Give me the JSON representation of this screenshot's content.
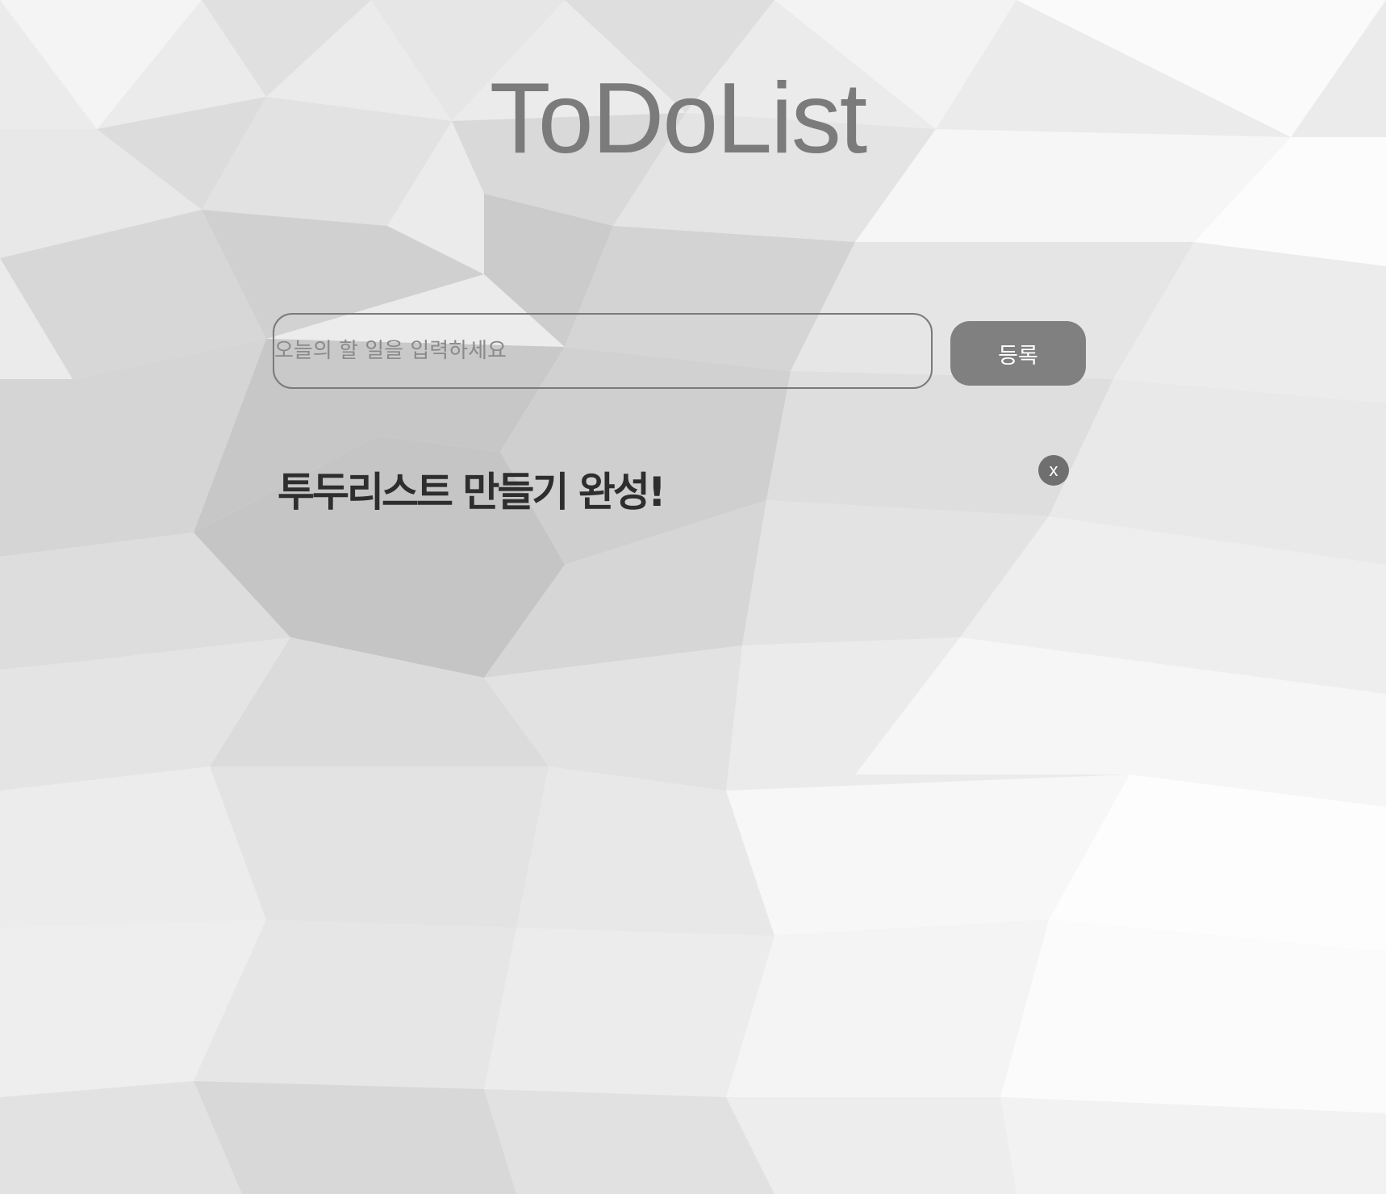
{
  "header": {
    "title": "ToDoList"
  },
  "form": {
    "input_placeholder": "오늘의 할 일을 입력하세요",
    "input_value": "",
    "submit_label": "등록"
  },
  "todos": [
    {
      "text": "투두리스트 만들기 완성!",
      "delete_label": "x"
    }
  ],
  "colors": {
    "button_bg": "#808080",
    "title": "#7b7b7b",
    "todo_text": "#2e2e2e"
  }
}
